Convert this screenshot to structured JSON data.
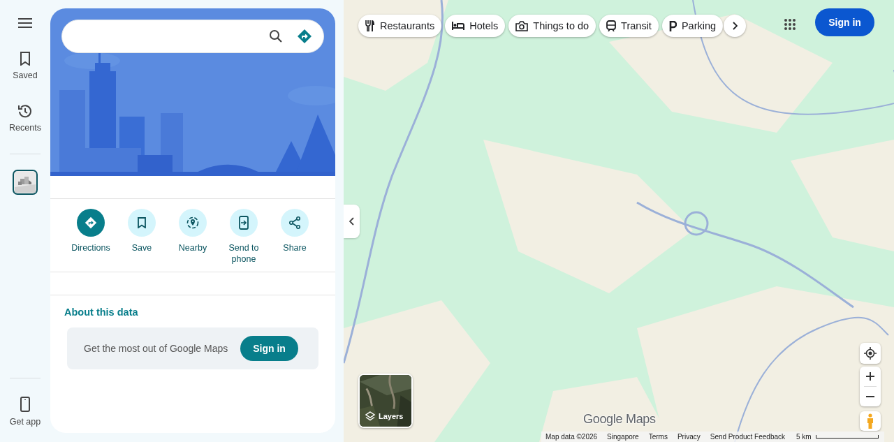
{
  "rail": {
    "items": [
      {
        "label": "Saved",
        "kind": "saved"
      },
      {
        "label": "Recents",
        "kind": "recents"
      }
    ],
    "bottom": {
      "label": "Get app"
    }
  },
  "actions": [
    {
      "label": "Directions",
      "kind": "directions",
      "primary": true
    },
    {
      "label": "Save",
      "kind": "save",
      "primary": false
    },
    {
      "label": "Nearby",
      "kind": "nearby",
      "primary": false
    },
    {
      "label": "Send to phone",
      "kind": "send",
      "primary": false
    },
    {
      "label": "Share",
      "kind": "share",
      "primary": false
    }
  ],
  "about": {
    "title": "About this data",
    "promo": "Get the most out of Google Maps",
    "button": "Sign in"
  },
  "chips": [
    {
      "label": "Restaurants",
      "kind": "restaurants"
    },
    {
      "label": "Hotels",
      "kind": "hotels"
    },
    {
      "label": "Things to do",
      "kind": "things"
    },
    {
      "label": "Transit",
      "kind": "transit"
    },
    {
      "label": "Parking",
      "kind": "parking"
    }
  ],
  "sign_in": "Sign in",
  "layers": "Layers",
  "logo": "Google Maps",
  "footer": [
    "Map data ©2026",
    "Singapore",
    "Terms",
    "Privacy",
    "Send Product Feedback"
  ],
  "scale": "5 km"
}
